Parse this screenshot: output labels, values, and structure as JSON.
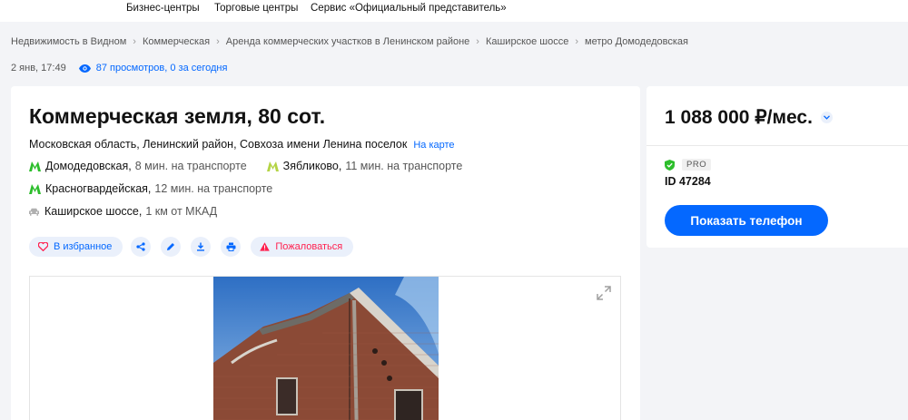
{
  "topnav": {
    "items": [
      "Бизнес-центры",
      "Торговые центры",
      "Сервис «Официальный представитель»"
    ]
  },
  "breadcrumb": {
    "items": [
      "Недвижимость в Видном",
      "Коммерческая",
      "Аренда коммерческих участков в Ленинском районе",
      "Каширское шоссе",
      "метро Домодедовская"
    ]
  },
  "meta": {
    "date": "2 янв, 17:49",
    "views": "87 просмотров, 0 за сегодня"
  },
  "listing": {
    "title": "Коммерческая земля, 80 сот.",
    "address": "Московская область, Ленинский район, Совхоза имени Ленина поселок",
    "map_link": "На карте",
    "metro": [
      {
        "station": "Домодедовская",
        "time": "8 мин. на транспорте",
        "color": "#2dbe2c"
      },
      {
        "station": "Зябликово",
        "time": "11 мин. на транспорте",
        "color": "#b4d445"
      },
      {
        "station": "Красногвардейская",
        "time": "12 мин. на транспорте",
        "color": "#2dbe2c"
      }
    ],
    "road": {
      "name": "Каширское шоссе,",
      "distance": "1 км от МКАД"
    }
  },
  "actions": {
    "favorite": "В избранное",
    "report": "Пожаловаться",
    "icons": [
      "heart-icon",
      "share-icon",
      "edit-icon",
      "download-icon",
      "print-icon",
      "warning-icon"
    ]
  },
  "sidebar": {
    "price": "1 088 000 ₽/мес.",
    "pro_label": "PRO",
    "agent_id": "ID 47284",
    "phone_button": "Показать телефон"
  },
  "colors": {
    "accent": "#0468ff",
    "danger": "#ff1f4e",
    "pill_bg": "#eaf0fb",
    "verified": "#2dbe2c"
  }
}
